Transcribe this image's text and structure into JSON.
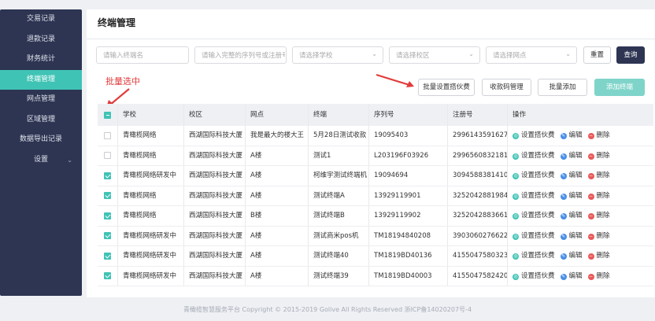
{
  "sidebar": {
    "items": [
      {
        "label": "交易记录",
        "active": false
      },
      {
        "label": "退款记录",
        "active": false
      },
      {
        "label": "财务统计",
        "active": false
      },
      {
        "label": "终端管理",
        "active": true
      },
      {
        "label": "网点管理",
        "active": false
      },
      {
        "label": "区域管理",
        "active": false
      },
      {
        "label": "数据导出记录",
        "active": false
      },
      {
        "label": "设置",
        "active": false
      }
    ]
  },
  "page": {
    "title": "终端管理"
  },
  "filters": {
    "terminal_name_placeholder": "请输入终端名",
    "serial_placeholder": "请输入完整的序列号或注册号",
    "school_placeholder": "请选择学校",
    "campus_placeholder": "请选择校区",
    "outlet_placeholder": "请选择网点",
    "reset_label": "重置",
    "search_label": "查询"
  },
  "annotation": {
    "batch_text": "批量选中"
  },
  "actions": {
    "batch_fee_label": "批量设置搭伙费",
    "qr_label": "收款码管理",
    "batch_add_label": "批量添加",
    "add_terminal_label": "添加终端"
  },
  "table": {
    "headers": [
      "学校",
      "校区",
      "网点",
      "终端",
      "序列号",
      "注册号",
      "操作"
    ],
    "row_actions": {
      "fee": "设置搭伙费",
      "edit": "编辑",
      "delete": "删除"
    },
    "rows": [
      {
        "checked": false,
        "school": "青橄榄网络",
        "campus": "西湖国际科技大厦",
        "outlet": "我是最大的楼大王",
        "terminal": "5月28日测试收款",
        "serial": "19095403",
        "reg": "29961435916271"
      },
      {
        "checked": false,
        "school": "青橄榄网络",
        "campus": "西湖国际科技大厦",
        "outlet": "A楼",
        "terminal": "测试1",
        "serial": "L203196F03926",
        "reg": "29965608321810"
      },
      {
        "checked": true,
        "school": "青橄榄网络研发中",
        "campus": "西湖国际科技大厦",
        "outlet": "A楼",
        "terminal": "柯维宇测试终端机",
        "serial": "19094694",
        "reg": "30945883814100"
      },
      {
        "checked": true,
        "school": "青橄榄网络",
        "campus": "西湖国际科技大厦",
        "outlet": "A楼",
        "terminal": "测试终端A",
        "serial": "13929119901",
        "reg": "32520428819841"
      },
      {
        "checked": true,
        "school": "青橄榄网络",
        "campus": "西湖国际科技大厦",
        "outlet": "B楼",
        "terminal": "测试终端B",
        "serial": "13929119902",
        "reg": "32520428836610"
      },
      {
        "checked": true,
        "school": "青橄榄网络研发中",
        "campus": "西湖国际科技大厦",
        "outlet": "A楼",
        "terminal": "测试商米pos机",
        "serial": "TM18194840208",
        "reg": "39030602766220"
      },
      {
        "checked": true,
        "school": "青橄榄网络研发中",
        "campus": "西湖国际科技大厦",
        "outlet": "A楼",
        "terminal": "测试终端40",
        "serial": "TM1819BD40136",
        "reg": "41550475803230"
      },
      {
        "checked": true,
        "school": "青橄榄网络研发中",
        "campus": "西湖国际科技大厦",
        "outlet": "A楼",
        "terminal": "测试终端39",
        "serial": "TM1819BD40003",
        "reg": "41550475824201"
      }
    ]
  },
  "footer": {
    "text": "青橄榄智慧服务平台 Copyright © 2015-2019 Golive All Rights Reserved  浙ICP备14020207号-4"
  },
  "colors": {
    "sidebar": "#2e3553",
    "accent": "#3fc3b5",
    "annotation": "#e23b3b"
  }
}
